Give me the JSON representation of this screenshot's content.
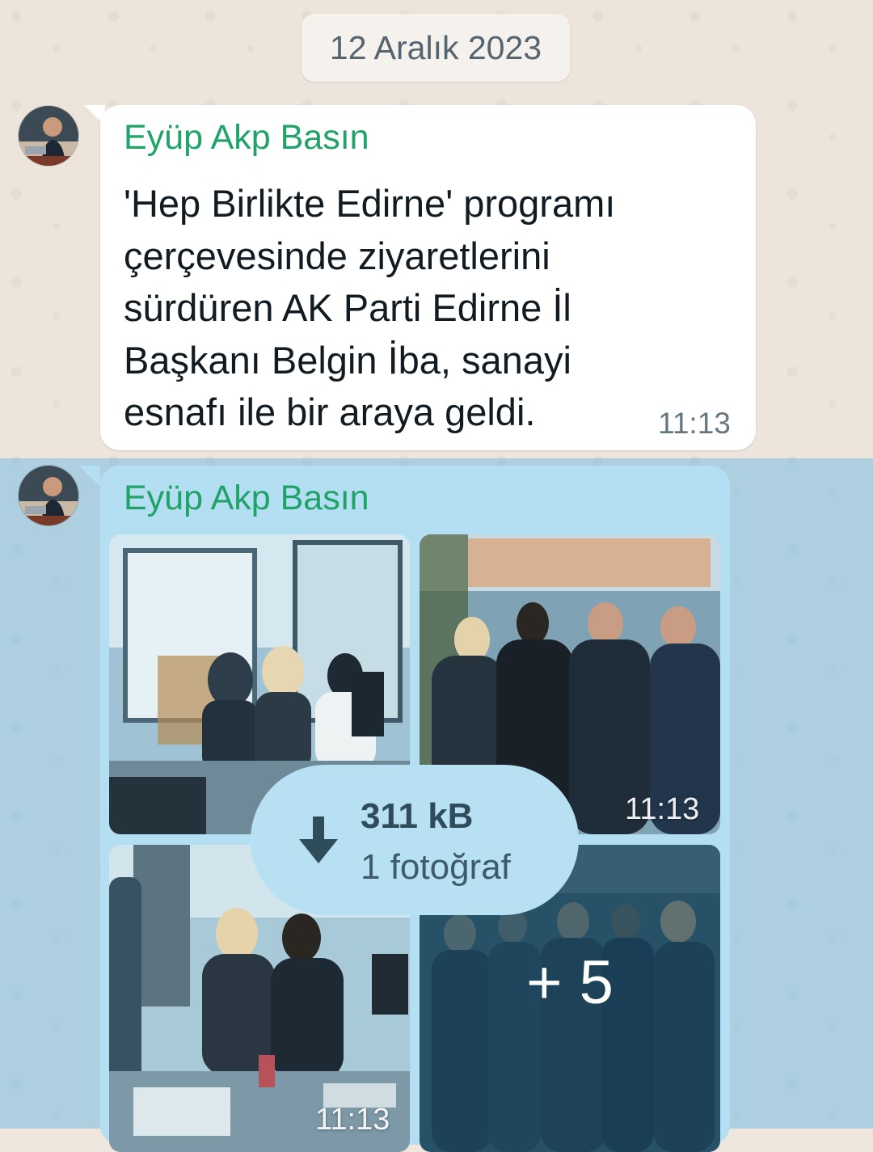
{
  "date_chip": "12 Aralık 2023",
  "messages": [
    {
      "sender": "Eyüp Akp Basın",
      "text": "'Hep Birlikte Edirne' programı\nçerçevesinde ziyaretlerini\nsürdüren AK Parti Edirne İl\nBaşkanı Belgin İba, sanayi\nesnafı ile bir araya geldi.",
      "time": "11:13"
    },
    {
      "sender": "Eyüp Akp Basın",
      "album": {
        "photos": [
          {
            "alt": "office-visit-photo"
          },
          {
            "alt": "group-outside-shop-photo",
            "time": "11:13"
          },
          {
            "alt": "desk-visit-photo",
            "time": "11:13"
          },
          {
            "alt": "group-photo-more",
            "more": "+ 5"
          }
        ],
        "download": {
          "size": "311 kB",
          "count": "1 fotoğraf"
        }
      }
    }
  ],
  "colors": {
    "sender": "#1fa369",
    "bubble_in": "#ffffff",
    "bubble_selected": "#b4def1",
    "wallpaper": "#ede5dc",
    "time_text": "#667781"
  }
}
